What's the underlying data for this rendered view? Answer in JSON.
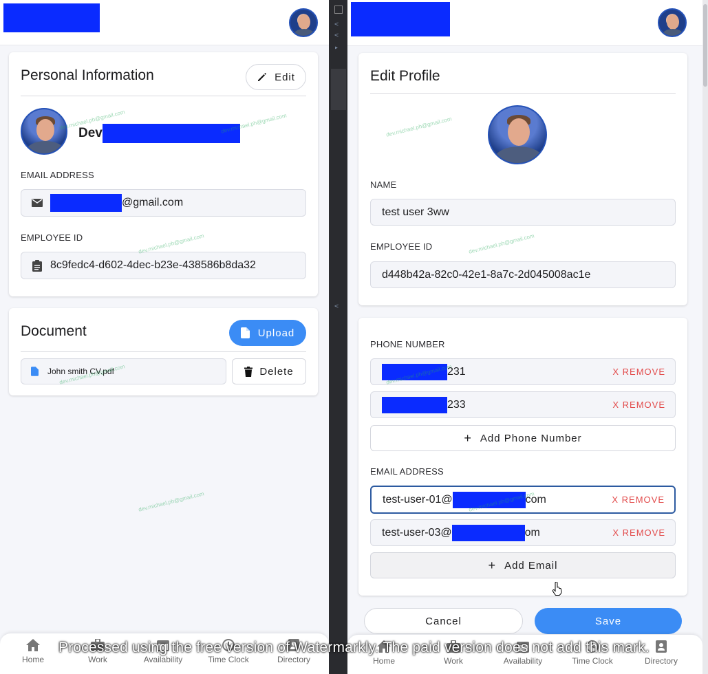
{
  "left": {
    "personal": {
      "title": "Personal Information",
      "edit_label": "Edit",
      "name_visible": "Dev",
      "email_label": "EMAIL ADDRESS",
      "email_suffix": "@gmail.com",
      "employee_label": "EMPLOYEE ID",
      "employee_id": "8c9fedc4-d602-4dec-b23e-438586b8da32"
    },
    "document": {
      "title": "Document",
      "upload_label": "Upload",
      "file_name": "John smith CV.pdf",
      "delete_label": "Delete"
    },
    "nav": [
      {
        "label": "Home",
        "icon": "home-icon"
      },
      {
        "label": "Work",
        "icon": "briefcase-icon"
      },
      {
        "label": "Availability",
        "icon": "calendar-icon"
      },
      {
        "label": "Time Clock",
        "icon": "clock-icon"
      },
      {
        "label": "Directory",
        "icon": "directory-icon"
      }
    ]
  },
  "right": {
    "edit_profile": {
      "title": "Edit Profile",
      "name_label": "NAME",
      "name_value": "test user 3ww",
      "employee_label": "EMPLOYEE ID",
      "employee_id": "d448b42a-82c0-42e1-8a7c-2d045008ac1e"
    },
    "contact": {
      "phone_label": "PHONE NUMBER",
      "phones": [
        {
          "suffix": "231",
          "remove_label": "X REMOVE"
        },
        {
          "suffix": "233",
          "remove_label": "X REMOVE"
        }
      ],
      "add_phone_label": "Add Phone Number",
      "email_label": "EMAIL ADDRESS",
      "emails": [
        {
          "prefix": "test-user-01@",
          "suffix": "com",
          "remove_label": "X REMOVE"
        },
        {
          "prefix": "test-user-03@",
          "suffix": "om",
          "remove_label": "X REMOVE"
        }
      ],
      "add_email_label": "Add Email"
    },
    "actions": {
      "cancel_label": "Cancel",
      "save_label": "Save"
    },
    "nav": [
      {
        "label": "Home",
        "icon": "home-icon"
      },
      {
        "label": "Work",
        "icon": "briefcase-icon"
      },
      {
        "label": "Availability",
        "icon": "calendar-icon"
      },
      {
        "label": "Time Clock",
        "icon": "clock-icon"
      },
      {
        "label": "Directory",
        "icon": "directory-icon"
      }
    ]
  },
  "watermark": "Processed using the free version of Watermarkly. The paid version does not add this mark.",
  "watermark_small": "dev.michael.ph@gmail.com",
  "colors": {
    "accent": "#3b8cf5",
    "redaction": "#0a2bff",
    "danger": "#e24a4a"
  }
}
